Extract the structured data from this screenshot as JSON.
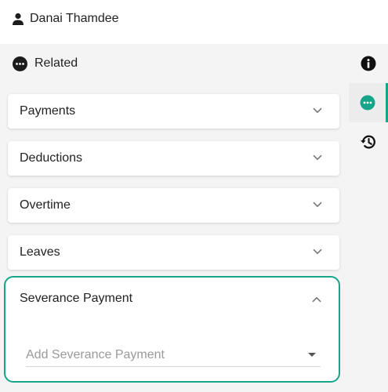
{
  "user": {
    "name": "Danai Thamdee",
    "icon": "person-icon"
  },
  "related": {
    "label": "Related",
    "icon": "more-dots-icon"
  },
  "rail": {
    "items": [
      {
        "icon": "info-icon",
        "active": false
      },
      {
        "icon": "more-dots-icon",
        "active": true
      },
      {
        "icon": "history-icon",
        "active": false
      }
    ]
  },
  "panels": [
    {
      "title": "Payments",
      "expanded": false
    },
    {
      "title": "Deductions",
      "expanded": false
    },
    {
      "title": "Overtime",
      "expanded": false
    },
    {
      "title": "Leaves",
      "expanded": false
    },
    {
      "title": "Severance Payment",
      "expanded": true
    }
  ],
  "severance": {
    "select_placeholder": "Add Severance Payment"
  },
  "colors": {
    "accent": "#17a58a",
    "panel_bg": "#f4f4f4"
  }
}
